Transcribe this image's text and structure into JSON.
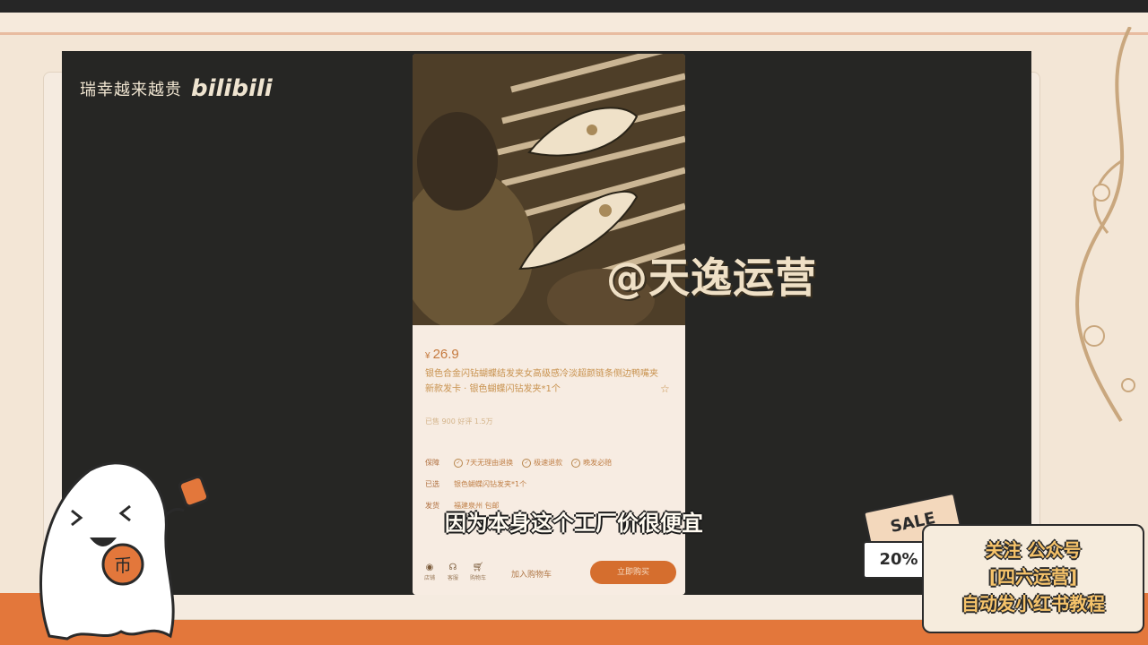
{
  "channel": {
    "name": "瑞幸越来越贵",
    "platform_logo": "bilibili"
  },
  "product": {
    "price_symbol": "¥",
    "price": "26.9",
    "title": "银色合金闪钻蝴蝶结发夹女高级感冷淡超颜链条侧边鸭嘴夹新款发卡 · 银色蝴蝶闪钻发夹*1个",
    "meta": "已售 900    好评 1.5万",
    "guarantee_label": "保障",
    "guarantees": [
      "7天无理由退换",
      "极速退款",
      "晚发必赔"
    ],
    "selected_label": "已选",
    "selected_value": "银色蝴蝶闪钻发夹*1个",
    "ship_label": "发货",
    "ship_value": "福建泉州    包邮",
    "bottom_icons": [
      {
        "label": "店铺"
      },
      {
        "label": "客服"
      },
      {
        "label": "购物车"
      }
    ],
    "cart_badge": "1",
    "add_to_cart": "加入购物车",
    "buy_now": "立即购买"
  },
  "watermark": "@天逸运营",
  "subtitle": "因为本身这个工厂价很便宜",
  "promo": {
    "sale": "SALE",
    "discount": "20%",
    "line1": "关注 公众号",
    "line2": "[四六运营]",
    "line3": "自动发小红书教程"
  },
  "colors": {
    "background": "#f3e6d6",
    "video_bg": "#262624",
    "accent_orange": "#e3773b",
    "buy_button": "#d56e2e"
  }
}
